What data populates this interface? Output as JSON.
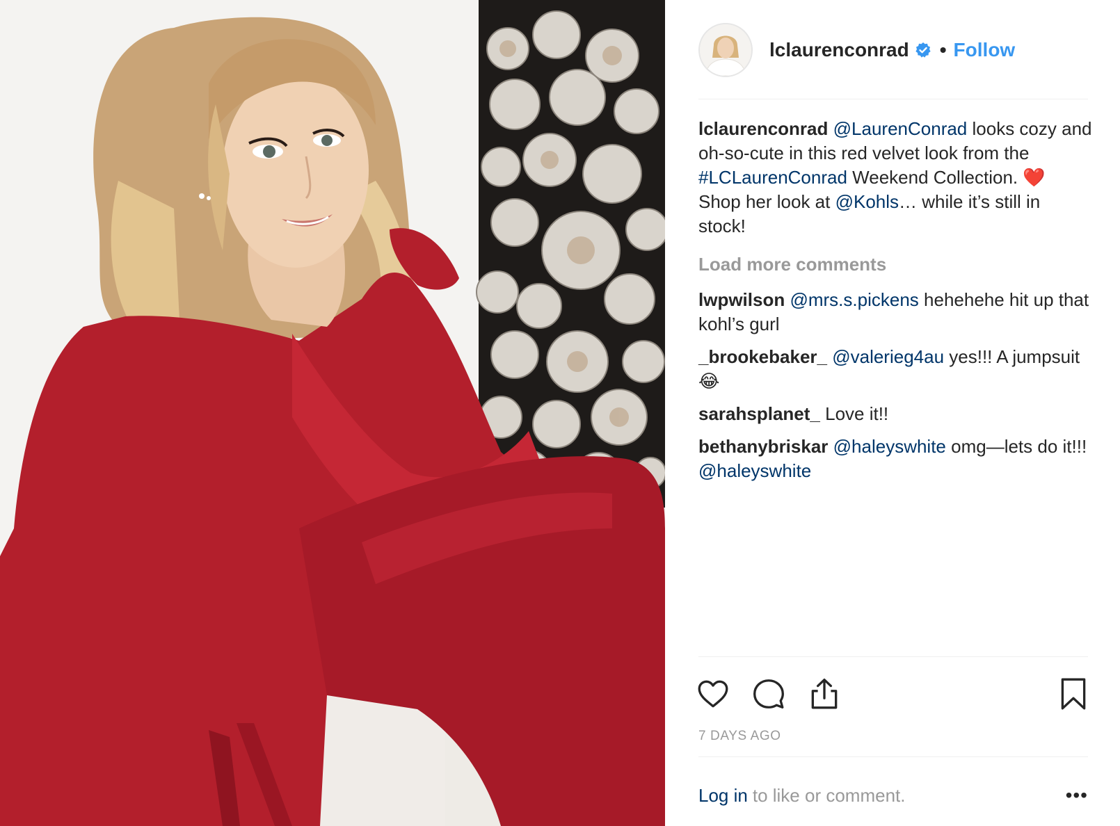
{
  "post": {
    "username": "lclaurenconrad",
    "follow_label": "Follow",
    "separator": "•",
    "caption": {
      "user": "lclaurenconrad",
      "mention1": "@LaurenConrad",
      "text1": " looks cozy and oh-so-cute in this red velvet look from the ",
      "hashtag": "#LCLaurenConrad",
      "text2": " Weekend Collection. ",
      "emoji": "❤️",
      "text3": "  Shop her look at ",
      "mention2": "@Kohls",
      "text4": "… while it’s still in stock!"
    },
    "load_more": "Load more comments",
    "comments": [
      {
        "user": "lwpwilson",
        "mention": "@mrs.s.pickens",
        "text": " hehehehe hit up that kohl’s gurl",
        "mention_after": ""
      },
      {
        "user": "_brookebaker_",
        "mention": "@valerieg4au",
        "text": " yes!!! A jumpsuit 😂",
        "mention_after": ""
      },
      {
        "user": "sarahsplanet_",
        "mention": "",
        "text": "Love it!!",
        "mention_after": ""
      },
      {
        "user": "bethanybriskar",
        "mention": "@haleyswhite",
        "text": " omg—lets do it!!! ",
        "mention_after": "@haleyswhite"
      }
    ],
    "timestamp": "7 DAYS AGO",
    "footer": {
      "login": "Log in",
      "rest": "to like or comment.",
      "more": "•••"
    },
    "icons": {
      "like": "heart-icon",
      "comment": "comment-bubble-icon",
      "share": "share-icon",
      "save": "bookmark-icon",
      "verified": "verified-badge-icon"
    },
    "colors": {
      "link": "#003569",
      "follow": "#3897f0",
      "muted": "#999999",
      "text": "#262626"
    }
  }
}
